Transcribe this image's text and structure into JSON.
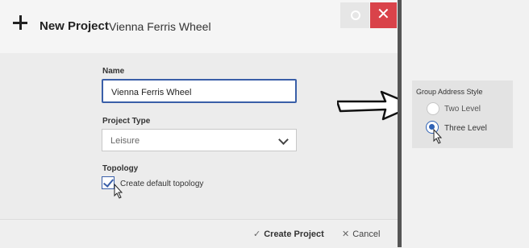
{
  "dialog": {
    "title": "New Project",
    "project_name_heading": "Vienna Ferris Wheel",
    "name_label": "Name",
    "name_value": "Vienna Ferris Wheel",
    "project_type_label": "Project Type",
    "project_type_value": "Leisure",
    "topology_label": "Topology",
    "create_default_topology_label": "Create default topology",
    "create_default_topology_checked": true,
    "create_button": "Create Project",
    "cancel_button": "Cancel",
    "create_glyph": "✓",
    "cancel_glyph": "✕",
    "close_glyph": "✕"
  },
  "group_address_style": {
    "title": "Group Address Style",
    "options": [
      {
        "label": "Two Level",
        "selected": false
      },
      {
        "label": "Three Level",
        "selected": true
      }
    ]
  },
  "colors": {
    "accent": "#3a5fa8",
    "close": "#d9434a",
    "divider": "#555555"
  }
}
